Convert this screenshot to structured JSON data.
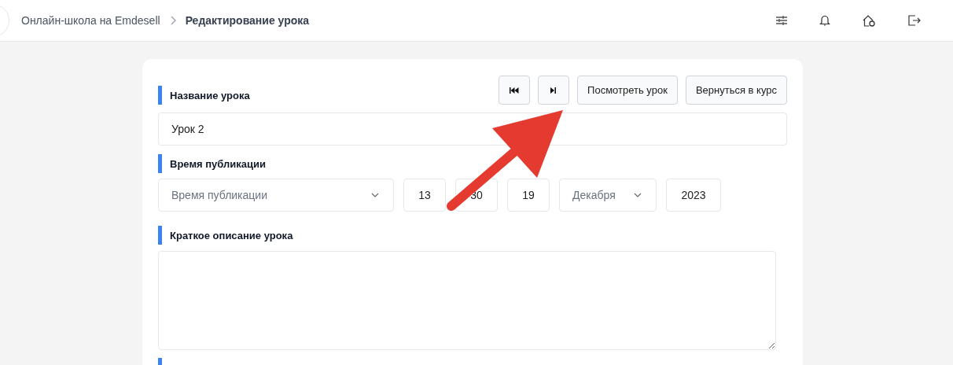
{
  "breadcrumbs": [
    {
      "label": "Онлайн-школа на Emdesell",
      "current": false
    },
    {
      "label": "Редактирование урока",
      "current": true
    }
  ],
  "form": {
    "nav_buttons": [
      {
        "kind": "first"
      },
      {
        "kind": "next"
      }
    ],
    "action_buttons": [
      "Посмотреть урок",
      "Вернуться в курс"
    ],
    "title_label": "Название урока",
    "title_value": "Урок 2",
    "publish_label": "Время публикации",
    "publish_select_placeholder": "Время публикации",
    "hour": "13",
    "minute": "30",
    "day": "19",
    "month": "Декабря",
    "year": "2023",
    "description_label": "Краткое описание урока"
  }
}
